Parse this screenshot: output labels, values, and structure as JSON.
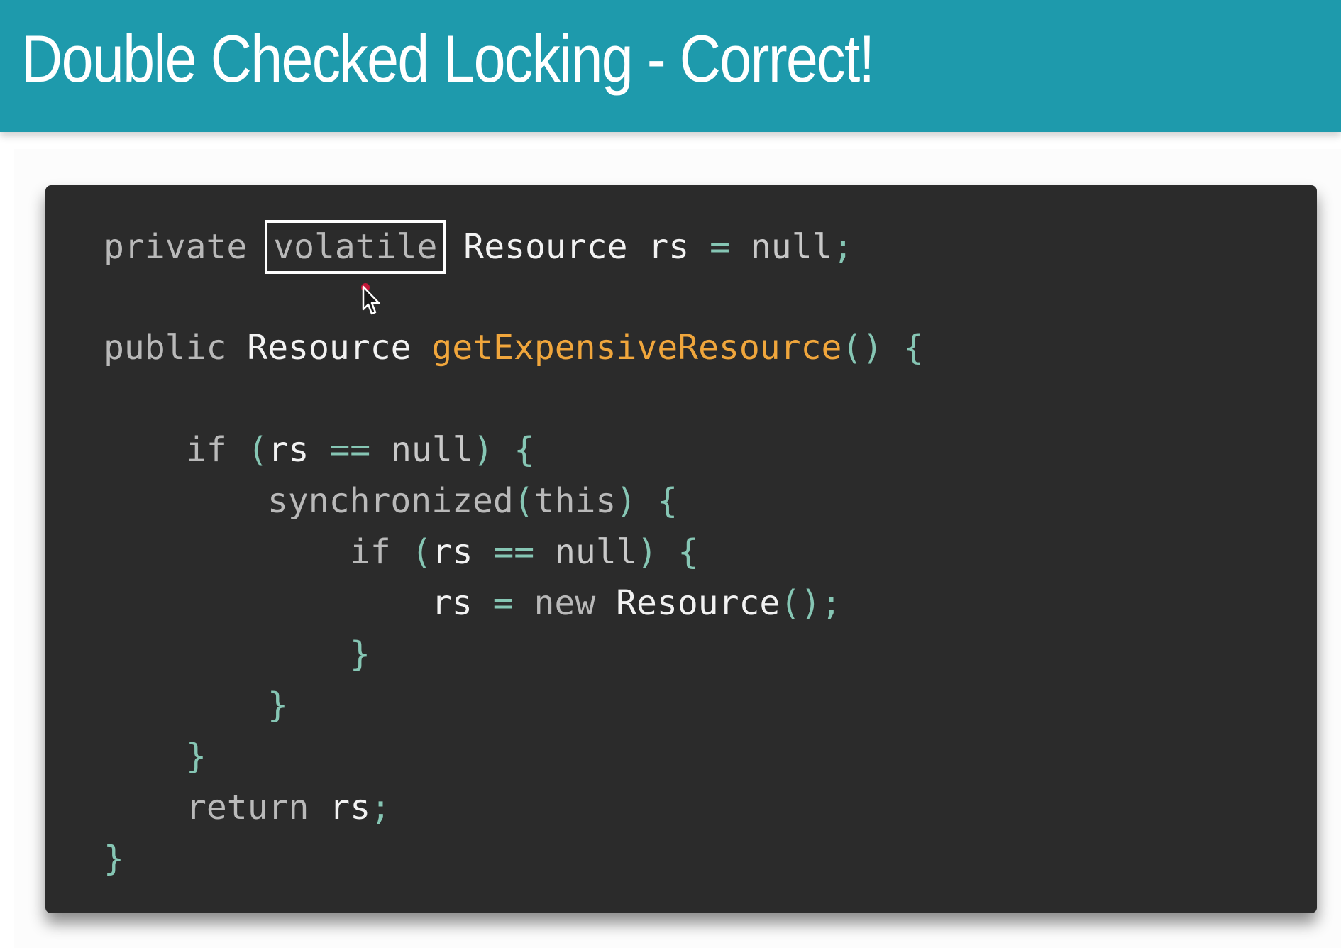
{
  "slide": {
    "title": "Double Checked Locking - Correct!"
  },
  "code": {
    "line1": {
      "private": "private",
      "volatile": "volatile",
      "type": "Resource",
      "name": "rs",
      "eq": "=",
      "value": "null",
      "semi": ";"
    },
    "line2": {
      "public": "public",
      "type": "Resource",
      "method": "getExpensiveResource",
      "parens": "()",
      "brace": "{"
    },
    "line3": {
      "kw": "if",
      "open": "(",
      "var": "rs",
      "op": "==",
      "value": "null",
      "close": ")",
      "brace": "{"
    },
    "line4": {
      "kw": "synchronized",
      "open": "(",
      "this": "this",
      "close": ")",
      "brace": "{"
    },
    "line5": {
      "kw": "if",
      "open": "(",
      "var": "rs",
      "op": "==",
      "value": "null",
      "close": ")",
      "brace": "{"
    },
    "line6": {
      "var": "rs",
      "eq": "=",
      "new": "new",
      "type": "Resource",
      "parens": "()",
      "semi": ";"
    },
    "line7": {
      "brace": "}"
    },
    "line8": {
      "brace": "}"
    },
    "line9": {
      "brace": "}"
    },
    "line10": {
      "kw": "return",
      "var": "rs",
      "semi": ";"
    },
    "line11": {
      "brace": "}"
    }
  },
  "colors": {
    "title_bar": "#1e9aac",
    "code_background": "#2b2b2b",
    "method_name": "#f0a63c",
    "punctuation": "#86c6b4",
    "highlight_border": "#ffffff"
  },
  "icons": {
    "cursor": "mouse-pointer-icon"
  }
}
